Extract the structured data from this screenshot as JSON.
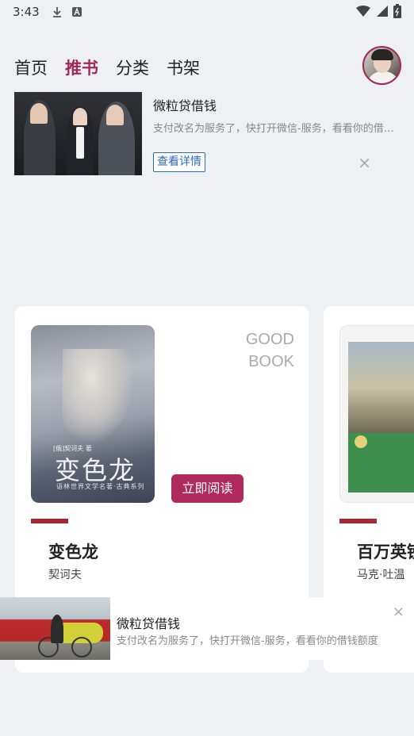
{
  "status_bar": {
    "time": "3:43",
    "icons": [
      "download-icon",
      "a-icon",
      "wifi-icon",
      "signal-icon",
      "battery-icon"
    ]
  },
  "nav": {
    "tabs": [
      {
        "label": "首页",
        "active": false
      },
      {
        "label": "推书",
        "active": true
      },
      {
        "label": "分类",
        "active": false
      },
      {
        "label": "书架",
        "active": false
      }
    ]
  },
  "ad_top": {
    "title": "微粒贷借钱",
    "description": "支付改名为服务了，快打开微信-服务，看看你的借钱额度",
    "detail_label": "查看详情",
    "close_glyph": "×"
  },
  "books": [
    {
      "cover_text": "变色龙",
      "cover_subtitle": "语林世界文学名著·古典系列",
      "cover_top_text": "[俄]契诃夫 著",
      "badge": [
        "GOOD",
        "BOOK"
      ],
      "read_label": "立即阅读",
      "title": "变色龙",
      "author": "契诃夫"
    },
    {
      "title": "百万英镑",
      "author": "马克·吐温"
    }
  ],
  "ad_bottom": {
    "title": "微粒贷借钱",
    "description": "支付改名为服务了，快打开微信-服务，看看你的借钱额度",
    "close_glyph": "×"
  },
  "colors": {
    "accent": "#b12a5e",
    "nav_active": "#a3285a",
    "bar_accent": "#a32936",
    "link_blue": "#2a6bc1",
    "background": "#eef0f4"
  }
}
